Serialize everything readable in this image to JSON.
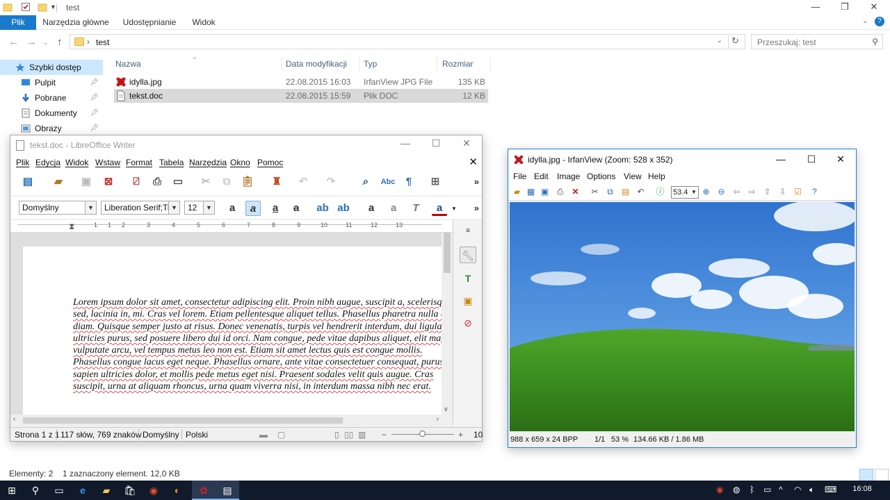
{
  "explorer": {
    "title": "test",
    "ribbon_tabs": [
      "Plik",
      "Narzędzia główne",
      "Udostępnianie",
      "Widok"
    ],
    "address": "test",
    "search_placeholder": "Przeszukaj: test",
    "nav": {
      "quick_access": "Szybki dostęp",
      "items": [
        "Pulpit",
        "Pobrane",
        "Dokumenty",
        "Obrazy"
      ]
    },
    "columns": [
      "Nazwa",
      "Data modyfikacji",
      "Typ",
      "Rozmiar"
    ],
    "files": [
      {
        "name": "idylla.jpg",
        "date": "22.08.2015 16:03",
        "type": "IrfanView JPG File",
        "size": "135 KB",
        "icon": "irfanview-file-icon"
      },
      {
        "name": "tekst.doc",
        "date": "22.08.2015 15:59",
        "type": "Plik DOC",
        "size": "12 KB",
        "icon": "doc-file-icon",
        "selected": true
      }
    ],
    "status": {
      "count": "Elementy: 2",
      "selection": "1 zaznaczony element. 12,0 KB"
    }
  },
  "writer": {
    "title": "tekst.doc - LibreOffice Writer",
    "menu": [
      "Plik",
      "Edycja",
      "Widok",
      "Wstaw",
      "Format",
      "Tabela",
      "Narzędzia",
      "Okno",
      "Pomoc"
    ],
    "style_value": "Domyślny",
    "font_value": "Liberation Serif;Tin",
    "size_value": "12",
    "ruler_numbers": [
      "1",
      "1",
      "2",
      "3",
      "4",
      "5",
      "6",
      "7",
      "8",
      "9",
      "10",
      "11",
      "12",
      "13"
    ],
    "body_text": "Lorem ipsum dolor sit amet, consectetur adipiscing elit. Proin nibh augue, suscipit a, scelerisque sed, lacinia in, mi. Cras vel lorem. Etiam pellentesque aliquet tellus. Phasellus pharetra nulla ac diam. Quisque semper justo at risus. Donec venenatis, turpis vel hendrerit interdum, dui ligula ultricies purus, sed posuere libero dui id orci. Nam congue, pede vitae dapibus aliquet, elit magna vulputate arcu, vel tempus metus leo non est. Etiam sit amet lectus quis est congue mollis. Phasellus congue lacus eget neque. Phasellus ornare, ante vitae consectetuer consequat, purus sapien ultricies dolor, et mollis pede metus eget nisi. Praesent sodales velit quis augue. Cras suscipit, urna at aliquam rhoncus, urna quam viverra nisi, in interdum massa nibh nec erat.",
    "status": {
      "page": "Strona 1 z 1",
      "words": "117 słów, 769 znaków",
      "style": "Domyślny",
      "language": "Polski",
      "zoom": "10"
    }
  },
  "irfan": {
    "title": "idylla.jpg - IrfanView (Zoom: 528 x 352)",
    "menu": [
      "File",
      "Edit",
      "Image",
      "Options",
      "View",
      "Help"
    ],
    "zoom_value": "53.4",
    "status": {
      "dims": "988 x 659 x 24 BPP",
      "page": "1/1",
      "zoom": "53 %",
      "size": "134.66 KB / 1.86 MB"
    }
  },
  "taskbar": {
    "clock": "16:08"
  },
  "colors": {
    "accent": "#1979ca",
    "selection": "#cce8ff",
    "taskbar": "#101a2a"
  }
}
